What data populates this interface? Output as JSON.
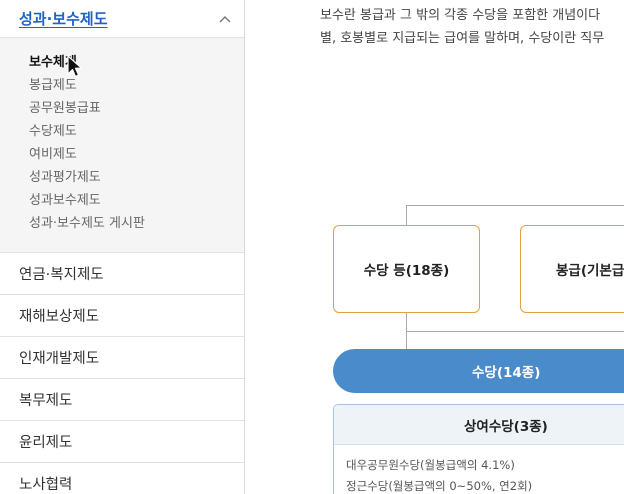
{
  "sidebar": {
    "section_title": "성과·보수제도",
    "sub_items": [
      "보수체계",
      "봉급제도",
      "공무원봉급표",
      "수당제도",
      "여비제도",
      "성과평가제도",
      "성과보수제도",
      "성과·보수제도 게시판"
    ],
    "menu_items": [
      "연금·복지제도",
      "재해보상제도",
      "인재개발제도",
      "복무제도",
      "윤리제도",
      "노사협력"
    ]
  },
  "main": {
    "paragraph_lines": [
      "보수란 봉급과 그 밖의 각종 수당을 포함한 개념이다",
      "별, 호봉별로 지급되는 급여를 말하며, 수당이란 직무"
    ],
    "diagram": {
      "box_allowance": "수당 등(18종)",
      "box_salary": "봉급(기본급)",
      "pill": "수당(14종)",
      "card_title": "상여수당(3종)",
      "card_lines": [
        "대우공무원수당(월봉급액의 4.1%)",
        "정근수당(월봉급액의 0~50%, 연2회)"
      ]
    }
  },
  "colors": {
    "accent_blue": "#1f63c7",
    "pill_blue": "#4a8bcc",
    "box_orange": "#e6a13f"
  }
}
